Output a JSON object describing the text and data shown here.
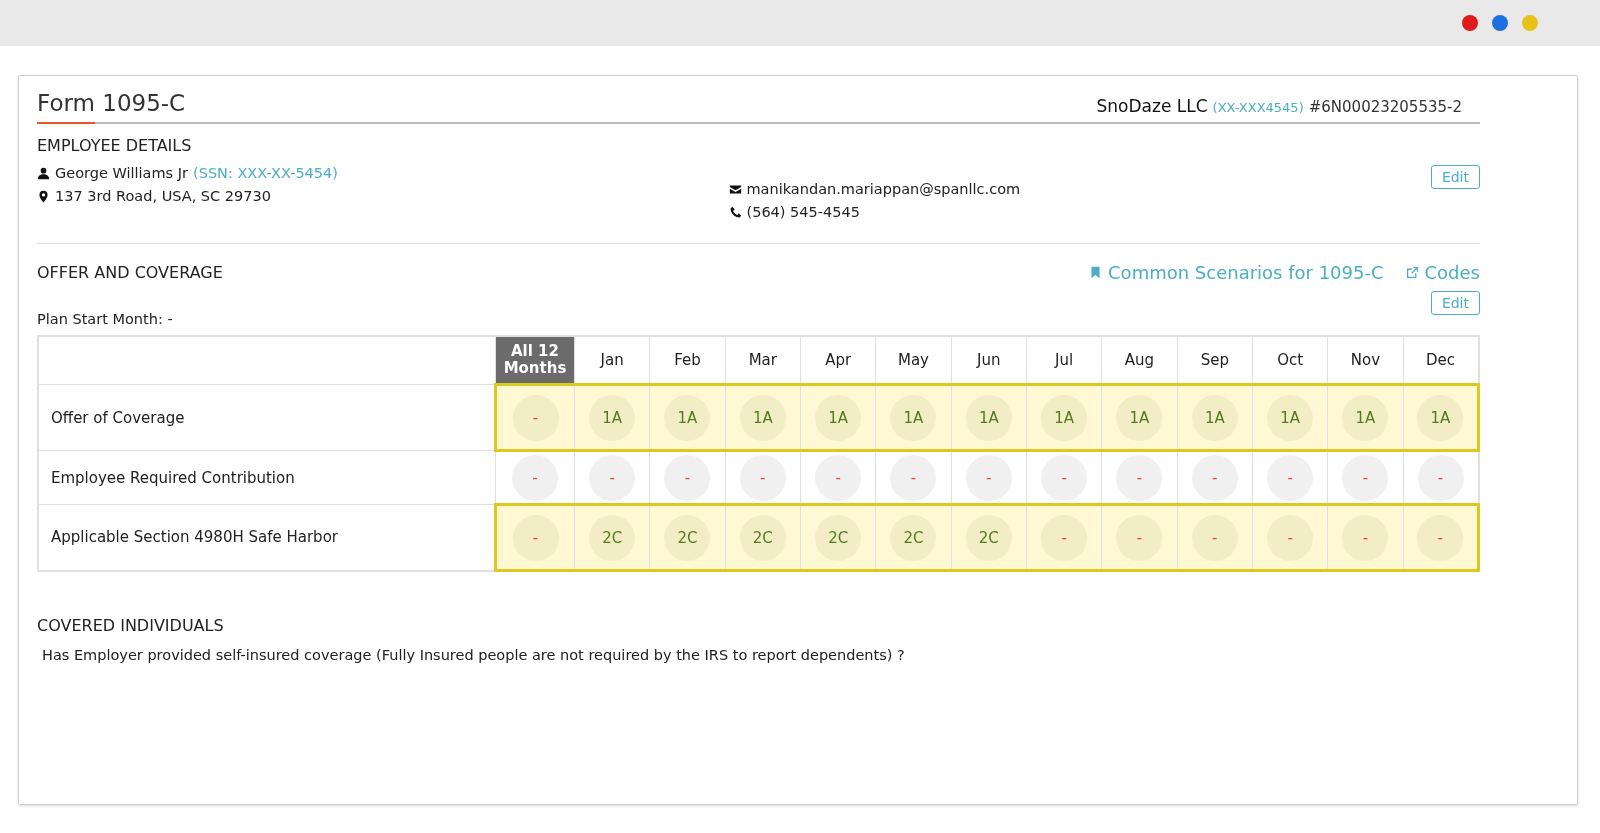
{
  "window_controls": [
    {
      "color": "#e01b1b"
    },
    {
      "color": "#1f6fe0"
    },
    {
      "color": "#e8c21a"
    }
  ],
  "form": {
    "title": "Form 1095-C",
    "company": "SnoDaze LLC",
    "company_ein": "(XX-XXX4545)",
    "company_id": "#6N00023205535-2"
  },
  "employee_details": {
    "heading": "EMPLOYEE DETAILS",
    "name": "George Williams Jr",
    "ssn": "(SSN: XXX-XX-5454)",
    "address": "137 3rd Road, USA, SC 29730",
    "email": "manikandan.mariappan@spanllc.com",
    "phone": "(564) 545-4545",
    "edit_button": "Edit"
  },
  "offer_and_coverage": {
    "heading": "OFFER AND COVERAGE",
    "links": [
      "Common Scenarios for 1095-C",
      "Codes"
    ],
    "edit_button": "Edit",
    "plan_start_month": "Plan Start Month: -",
    "table": {
      "columns": [
        "All 12 Months",
        "Jan",
        "Feb",
        "Mar",
        "Apr",
        "May",
        "Jun",
        "Jul",
        "Aug",
        "Sep",
        "Oct",
        "Nov",
        "Dec"
      ],
      "rows": [
        {
          "label": "Offer of Coverage",
          "highlighted": true,
          "cells": [
            {
              "value": "-",
              "kind": "none"
            },
            {
              "value": "1A",
              "kind": "code"
            },
            {
              "value": "1A",
              "kind": "code"
            },
            {
              "value": "1A",
              "kind": "code"
            },
            {
              "value": "1A",
              "kind": "code"
            },
            {
              "value": "1A",
              "kind": "code"
            },
            {
              "value": "1A",
              "kind": "code"
            },
            {
              "value": "1A",
              "kind": "code"
            },
            {
              "value": "1A",
              "kind": "code"
            },
            {
              "value": "1A",
              "kind": "code"
            },
            {
              "value": "1A",
              "kind": "code"
            },
            {
              "value": "1A",
              "kind": "code"
            },
            {
              "value": "1A",
              "kind": "code"
            }
          ]
        },
        {
          "label": "Employee Required Contribution",
          "highlighted": false,
          "cells": [
            {
              "value": "-",
              "kind": "none"
            },
            {
              "value": "-",
              "kind": "none"
            },
            {
              "value": "-",
              "kind": "none"
            },
            {
              "value": "-",
              "kind": "none"
            },
            {
              "value": "-",
              "kind": "none"
            },
            {
              "value": "-",
              "kind": "none"
            },
            {
              "value": "-",
              "kind": "none"
            },
            {
              "value": "-",
              "kind": "none"
            },
            {
              "value": "-",
              "kind": "none"
            },
            {
              "value": "-",
              "kind": "none"
            },
            {
              "value": "-",
              "kind": "none"
            },
            {
              "value": "-",
              "kind": "none"
            },
            {
              "value": "-",
              "kind": "none"
            }
          ]
        },
        {
          "label": "Applicable Section 4980H Safe Harbor",
          "highlighted": true,
          "cells": [
            {
              "value": "-",
              "kind": "none"
            },
            {
              "value": "2C",
              "kind": "code"
            },
            {
              "value": "2C",
              "kind": "code"
            },
            {
              "value": "2C",
              "kind": "code"
            },
            {
              "value": "2C",
              "kind": "code"
            },
            {
              "value": "2C",
              "kind": "code"
            },
            {
              "value": "2C",
              "kind": "code"
            },
            {
              "value": "-",
              "kind": "none"
            },
            {
              "value": "-",
              "kind": "none"
            },
            {
              "value": "-",
              "kind": "none"
            },
            {
              "value": "-",
              "kind": "none"
            },
            {
              "value": "-",
              "kind": "none"
            },
            {
              "value": "-",
              "kind": "none"
            }
          ]
        }
      ]
    }
  },
  "covered_individuals": {
    "heading": "COVERED INDIVIDUALS",
    "question": "Has Employer provided self-insured coverage (Fully Insured people are not required by the IRS to report dependents) ?"
  }
}
